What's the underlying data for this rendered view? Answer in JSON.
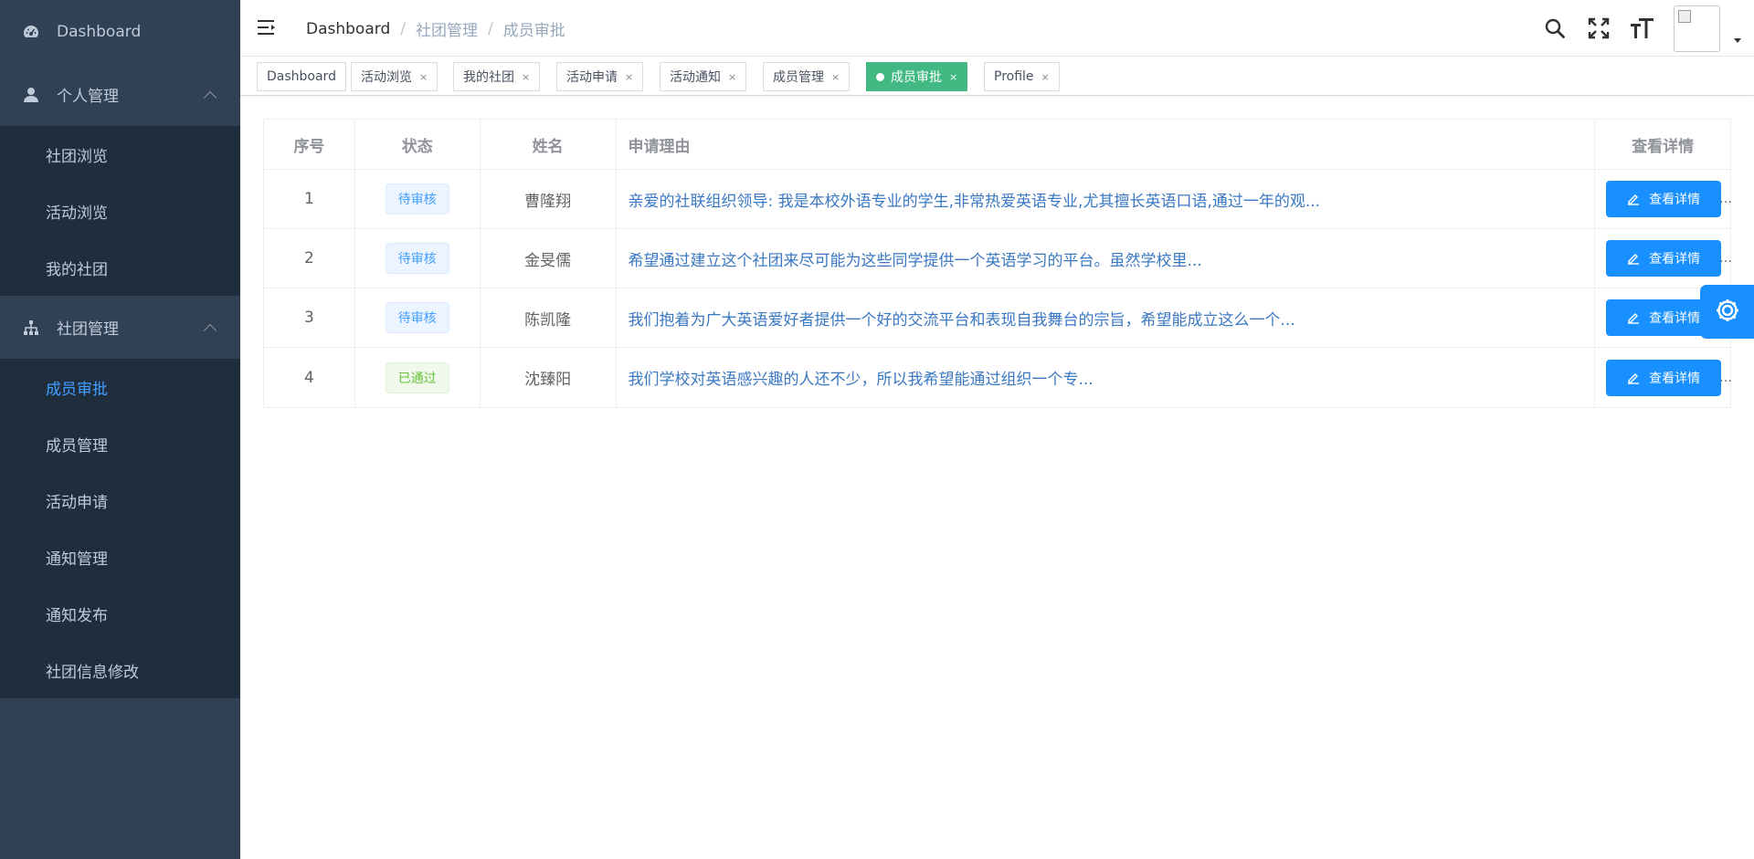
{
  "sidebar": {
    "dashboard": "Dashboard",
    "personal": "个人管理",
    "personal_items": [
      "社团浏览",
      "活动浏览",
      "我的社团"
    ],
    "club": "社团管理",
    "club_items": [
      "成员审批",
      "成员管理",
      "活动申请",
      "通知管理",
      "通知发布",
      "社团信息修改"
    ],
    "active_item": "成员审批",
    "active_color": "#409eff"
  },
  "breadcrumb": [
    "Dashboard",
    "社团管理",
    "成员审批"
  ],
  "tags": [
    {
      "label": "Dashboard",
      "closable": false,
      "active": false
    },
    {
      "label": "活动浏览",
      "closable": true,
      "active": false
    },
    {
      "label": "我的社团",
      "closable": true,
      "active": false
    },
    {
      "label": "活动申请",
      "closable": true,
      "active": false
    },
    {
      "label": "活动通知",
      "closable": true,
      "active": false
    },
    {
      "label": "成员管理",
      "closable": true,
      "active": false
    },
    {
      "label": "成员审批",
      "closable": true,
      "active": true
    },
    {
      "label": "Profile",
      "closable": true,
      "active": false
    }
  ],
  "tag_close": "×",
  "table": {
    "headers": [
      "序号",
      "状态",
      "姓名",
      "申请理由",
      "查看详情"
    ],
    "rows": [
      {
        "no": "1",
        "status": "待审核",
        "name": "曹隆翔",
        "reason": "亲爱的社联组织领导: 我是本校外语专业的学生,非常热爱英语专业,尤其擅长英语口语,通过一年的观...",
        "action": "查看详情"
      },
      {
        "no": "2",
        "status": "待审核",
        "name": "金旻儒",
        "reason": "希望通过建立这个社团来尽可能为这些同学提供一个英语学习的平台。虽然学校里...",
        "action": "查看详情"
      },
      {
        "no": "3",
        "status": "待审核",
        "name": "陈凯隆",
        "reason": "我们抱着为广大英语爱好者提供一个好的交流平台和表现自我舞台的宗旨，希望能成立这么一个...",
        "action": "查看详情"
      },
      {
        "no": "4",
        "status": "已通过",
        "name": "沈臻阳",
        "reason": "我们学校对英语感兴趣的人还不少，所以我希望能通过组织一个专...",
        "action": "查看详情"
      }
    ]
  },
  "colors": {
    "sidebar_bg": "#304156",
    "submenu_bg": "#1f2d3d",
    "tag_active": "#42b983",
    "primary": "#1890ff"
  },
  "icons": [
    "dashboard-icon",
    "user-icon",
    "tree-icon",
    "hamburger-icon",
    "search-icon",
    "fullscreen-icon",
    "font-size-icon",
    "edit-icon",
    "settings-icon"
  ]
}
